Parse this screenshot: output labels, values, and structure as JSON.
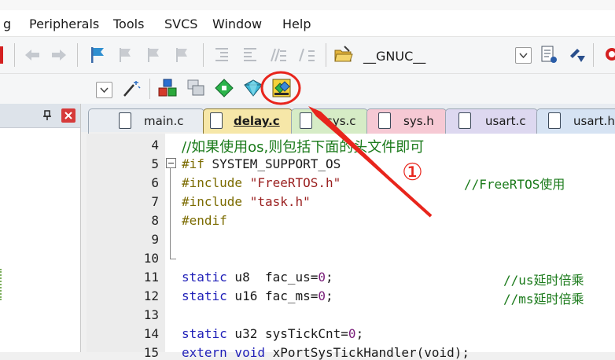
{
  "menu": {
    "items": [
      "g",
      "Peripherals",
      "Tools",
      "SVCS",
      "Window",
      "Help"
    ]
  },
  "toolbar": {
    "target_dropdown": "__GNUC__"
  },
  "tabs": [
    {
      "label": "main.c",
      "color": "#d6e3f3"
    },
    {
      "label": "delay.c",
      "color": "#f6e7a8",
      "active": true
    },
    {
      "label": "sys.c",
      "color": "#d6ecc6"
    },
    {
      "label": "sys.h",
      "color": "#f6c9d4"
    },
    {
      "label": "usart.c",
      "color": "#ddd8f0"
    },
    {
      "label": "usart.h",
      "color": "#d6e3f3"
    }
  ],
  "annotation": {
    "marker": "①",
    "color": "#e8251c"
  },
  "code": {
    "line_numbers": [
      "4",
      "5",
      "6",
      "7",
      "8",
      "9",
      "10",
      "11",
      "12",
      "13",
      "14",
      "15"
    ],
    "l4_comment": "//如果使用os,则包括下面的头文件即可",
    "l5_directive": "#if",
    "l5_rest": " SYSTEM_SUPPORT_OS",
    "l6_directive": "#include",
    "l6_string": "\"FreeRTOS.h\"",
    "l6_comment": "//FreeRTOS使用",
    "l7_directive": "#include",
    "l7_string": "\"task.h\"",
    "l8_directive": "#endif",
    "l11_kw": "static",
    "l11_rest": " u8  fac_us=",
    "l11_num": "0",
    "l11_semi": ";",
    "l11_comment": "//us延时倍乘",
    "l12_kw": "static",
    "l12_rest": " u16 fac_ms=",
    "l12_num": "0",
    "l12_semi": ";",
    "l12_comment": "//ms延时倍乘",
    "l14_kw": "static",
    "l14_rest": " u32 sysTickCnt=",
    "l14_num": "0",
    "l14_semi": ";",
    "l15_kw": "extern void",
    "l15_rest": " xPortSysTickHandler(void);"
  }
}
